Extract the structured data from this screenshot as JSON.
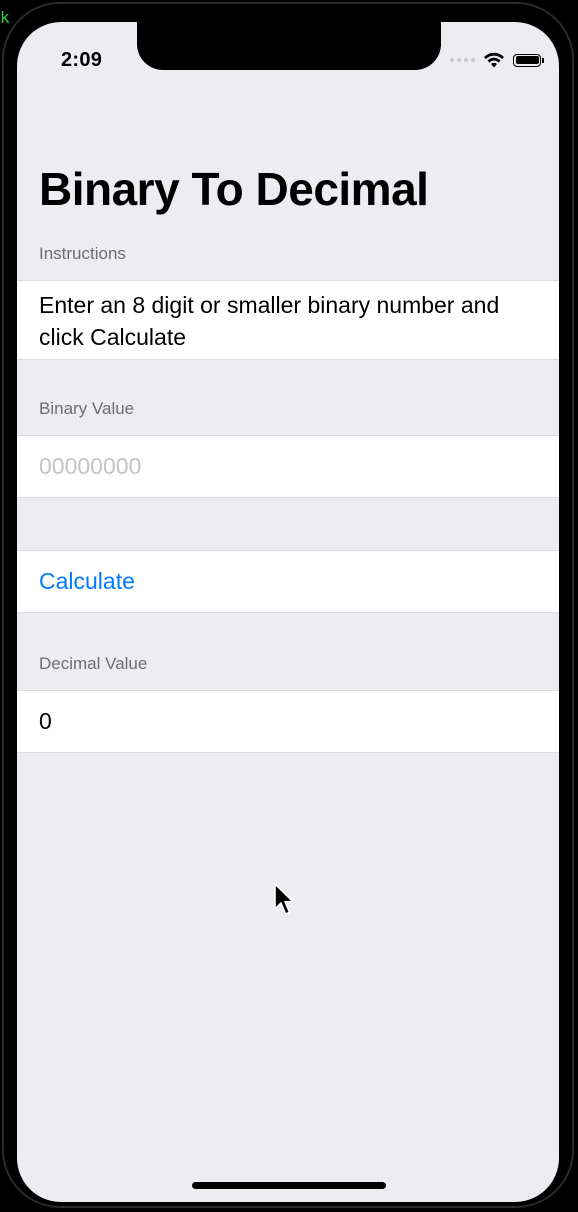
{
  "status_bar": {
    "time": "2:09",
    "icons": [
      "signal-dots-icon",
      "wifi-icon",
      "battery-icon"
    ]
  },
  "nav": {
    "large_title": "Binary To Decimal"
  },
  "sections": {
    "instructions": {
      "header": "Instructions",
      "text": "Enter an 8 digit or smaller binary number and click Calculate"
    },
    "binary_value": {
      "header": "Binary Value",
      "placeholder": "00000000",
      "value": ""
    },
    "calculate": {
      "button_label": "Calculate"
    },
    "decimal_value": {
      "header": "Decimal Value",
      "value": "0"
    }
  },
  "colors": {
    "accent": "#007aff",
    "background": "#efeff4",
    "cell_background": "#ffffff",
    "section_header": "#6d6d72",
    "placeholder": "#c4c4c7"
  },
  "corner_glyph": "k"
}
